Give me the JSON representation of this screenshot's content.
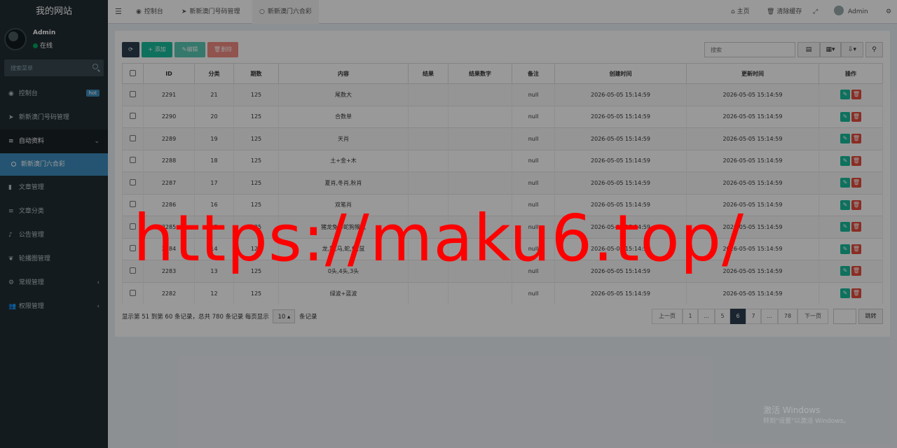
{
  "sidebar": {
    "site_name": "我的网站",
    "user_name": "Admin",
    "user_status": "在线",
    "search_placeholder": "搜索菜单",
    "items": [
      {
        "label": "控制台",
        "icon": "dashboard-icon",
        "badge": "hot"
      },
      {
        "label": "新新澳门号码管理",
        "icon": "send-icon"
      },
      {
        "label": "自动资料",
        "icon": "list-icon"
      },
      {
        "label": "新新澳门六合彩",
        "icon": "circle-icon"
      },
      {
        "label": "文章管理",
        "icon": "bookmark-icon"
      },
      {
        "label": "文章分类",
        "icon": "list-icon"
      },
      {
        "label": "公告管理",
        "icon": "bell-icon"
      },
      {
        "label": "轮播图管理",
        "icon": "leaf-icon"
      },
      {
        "label": "常规管理",
        "icon": "cogs-icon"
      },
      {
        "label": "权限管理",
        "icon": "users-icon"
      }
    ]
  },
  "topbar": {
    "tabs": [
      "控制台",
      "新新澳门号码管理",
      "新新澳门六合彩"
    ],
    "home": "主页",
    "clear_cache": "清除缓存",
    "admin": "Admin"
  },
  "toolbar": {
    "add": "添加",
    "edit": "编辑",
    "delete": "删除",
    "search_placeholder": "搜索"
  },
  "table": {
    "headers": [
      "ID",
      "分类",
      "期数",
      "内容",
      "结果",
      "结果数字",
      "备注",
      "创建时间",
      "更新时间",
      "操作"
    ],
    "rows": [
      {
        "id": "2291",
        "cat": "21",
        "issue": "125",
        "content": "尾数大",
        "result": "",
        "result_num": "",
        "note": "null",
        "created": "2026-05-05 15:14:59",
        "updated": "2026-05-05 15:14:59"
      },
      {
        "id": "2290",
        "cat": "20",
        "issue": "125",
        "content": "合数单",
        "result": "",
        "result_num": "",
        "note": "null",
        "created": "2026-05-05 15:14:59",
        "updated": "2026-05-05 15:14:59"
      },
      {
        "id": "2289",
        "cat": "19",
        "issue": "125",
        "content": "天肖",
        "result": "",
        "result_num": "",
        "note": "null",
        "created": "2026-05-05 15:14:59",
        "updated": "2026-05-05 15:14:59"
      },
      {
        "id": "2288",
        "cat": "18",
        "issue": "125",
        "content": "土+金+木",
        "result": "",
        "result_num": "",
        "note": "null",
        "created": "2026-05-05 15:14:59",
        "updated": "2026-05-05 15:14:59"
      },
      {
        "id": "2287",
        "cat": "17",
        "issue": "125",
        "content": "夏肖,冬肖,秋肖",
        "result": "",
        "result_num": "",
        "note": "null",
        "created": "2026-05-05 15:14:59",
        "updated": "2026-05-05 15:14:59"
      },
      {
        "id": "2286",
        "cat": "16",
        "issue": "125",
        "content": "双笔肖",
        "result": "",
        "result_num": "",
        "note": "null",
        "created": "2026-05-05 15:14:59",
        "updated": "2026-05-05 15:14:59"
      },
      {
        "id": "2285",
        "cat": "15",
        "issue": "125",
        "content": "猪龙兔羊蛇狗猴鼠",
        "result": "",
        "result_num": "",
        "note": "null",
        "created": "2026-05-05 15:14:59",
        "updated": "2026-05-05 15:14:59"
      },
      {
        "id": "2284",
        "cat": "14",
        "issue": "125",
        "content": "龙,猪,马,蛇,兔,鼠",
        "result": "",
        "result_num": "",
        "note": "null",
        "created": "2026-05-05 15:14:59",
        "updated": "2026-05-05 15:14:59"
      },
      {
        "id": "2283",
        "cat": "13",
        "issue": "125",
        "content": "0头,4头,3头",
        "result": "",
        "result_num": "",
        "note": "null",
        "created": "2026-05-05 15:14:59",
        "updated": "2026-05-05 15:14:59"
      },
      {
        "id": "2282",
        "cat": "12",
        "issue": "125",
        "content": "绿波+蓝波",
        "result": "",
        "result_num": "",
        "note": "null",
        "created": "2026-05-05 15:14:59",
        "updated": "2026-05-05 15:14:59"
      }
    ]
  },
  "pagination": {
    "info_prefix": "显示第 51 到第 60 条记录，总共 780 条记录 每页显示",
    "page_size": "10",
    "info_suffix": "条记录",
    "prev": "上一页",
    "next": "下一页",
    "pages": [
      "1",
      "...",
      "5",
      "6",
      "7",
      "...",
      "78"
    ],
    "current": "6",
    "jump": "跳转"
  },
  "overlay": {
    "watermark": "https://maku6.top/",
    "windows_title": "激活 Windows",
    "windows_sub": "转到\"设置\"以激活 Windows。"
  },
  "colors": {
    "sidebar_bg": "#222d32",
    "active_menu": "#3c8dbc",
    "add_button": "#18bc9c",
    "delete_button": "#e74c3c",
    "refresh_button": "#2c3e50",
    "watermark": "#ff0000"
  }
}
